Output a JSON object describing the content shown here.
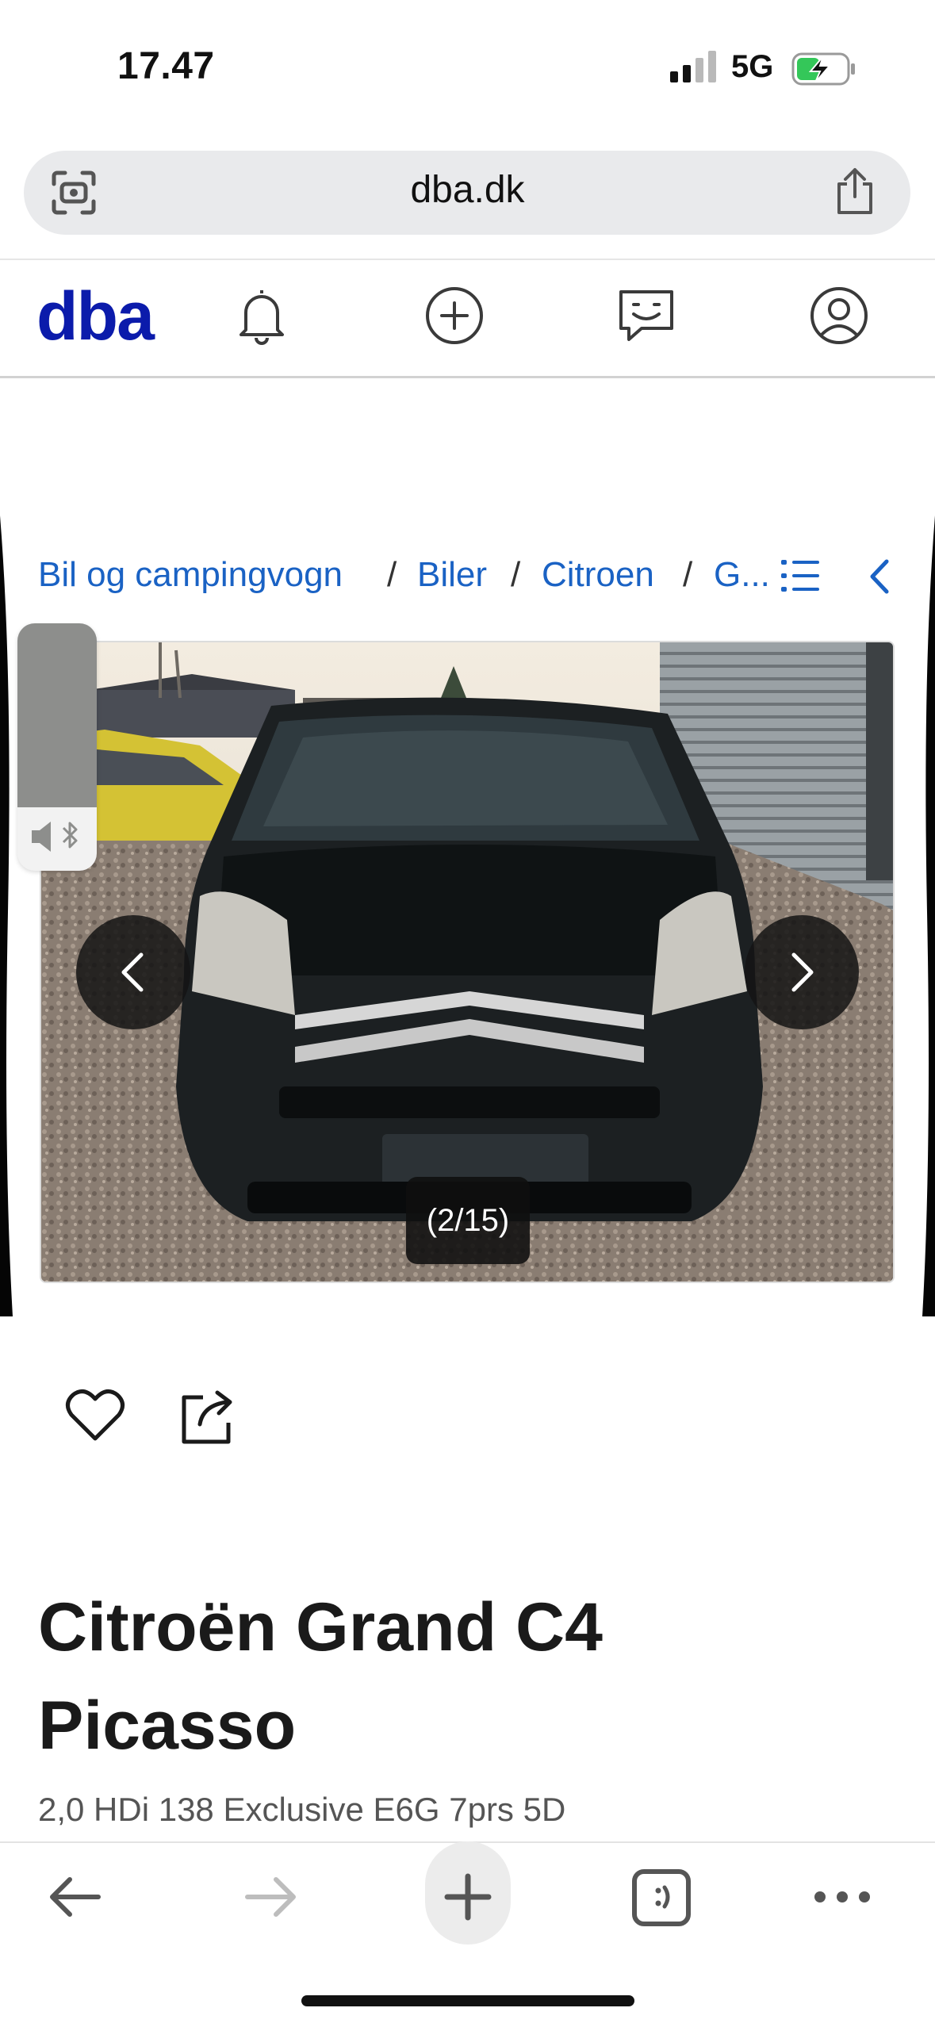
{
  "status_bar": {
    "time": "17.47",
    "network": "5G",
    "signal_bars": 2,
    "battery_charging": true
  },
  "browser": {
    "url": "dba.dk"
  },
  "site_header": {
    "logo": "dba",
    "icons": [
      "bell-icon",
      "plus-circle-icon",
      "chat-icon",
      "profile-icon"
    ]
  },
  "breadcrumb": {
    "items": [
      "Bil og campingvogn",
      "Biler",
      "Citroen",
      "G..."
    ],
    "separator": "/"
  },
  "gallery": {
    "counter": "(2/15)",
    "current": 2,
    "total": 15
  },
  "listing": {
    "title_line1": "Citroën Grand C4",
    "title_line2": "Picasso",
    "subtitle": "2,0 HDi 138 Exclusive E6G 7prs 5D"
  },
  "colors": {
    "brand": "#0b1bab",
    "link": "#1a62c4"
  }
}
